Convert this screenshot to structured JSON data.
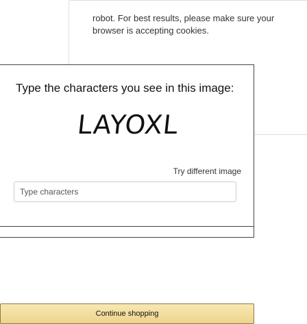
{
  "intro_text": "robot. For best results, please make sure your browser is accepting cookies.",
  "captcha": {
    "prompt": "Type the characters you see in this image:",
    "captcha_text": "LAYOXL",
    "try_different_label": "Try different image",
    "input_placeholder": "Type characters",
    "input_value": ""
  },
  "continue_label": "Continue shopping"
}
